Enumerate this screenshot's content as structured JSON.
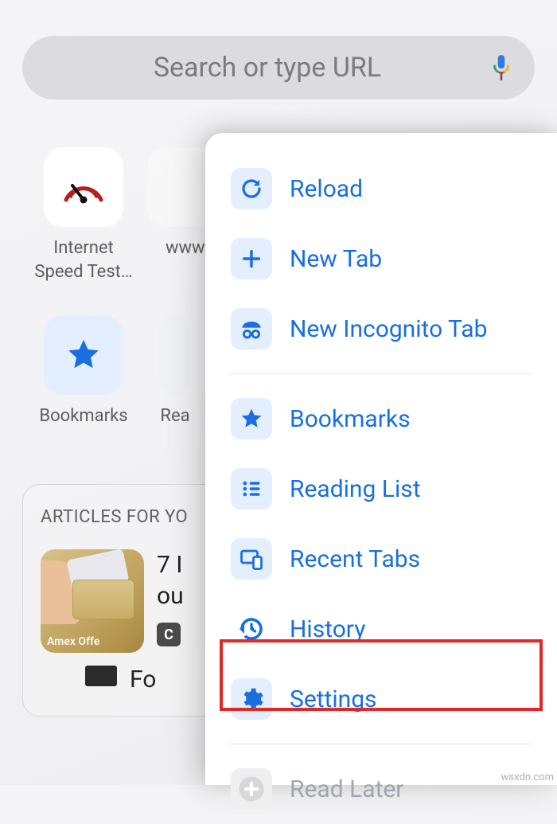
{
  "search": {
    "placeholder": "Search or type URL"
  },
  "shortcuts": [
    {
      "label": "Internet Speed Test…"
    },
    {
      "label": "www."
    },
    {
      "label": "Bookmarks"
    },
    {
      "label": "Rea"
    }
  ],
  "articles": {
    "heading": "ARTICLES FOR YO",
    "item1": {
      "title_a": "7 I",
      "title_b": "ou",
      "thumb_caption": "Amex Offe",
      "badge": "C"
    },
    "item2": {
      "title": "Fo"
    }
  },
  "menu": {
    "reload": "Reload",
    "new_tab": "New Tab",
    "incognito": "New Incognito Tab",
    "bookmarks": "Bookmarks",
    "reading_list": "Reading List",
    "recent_tabs": "Recent Tabs",
    "history": "History",
    "settings": "Settings",
    "read_later": "Read Later"
  },
  "watermark": "wsxdn.com"
}
